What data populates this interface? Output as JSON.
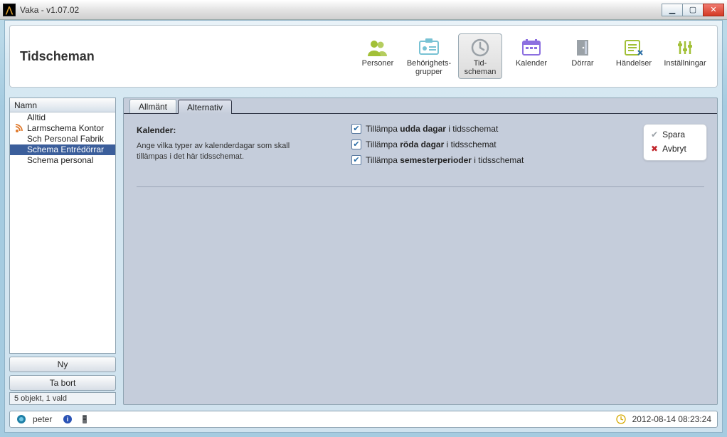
{
  "window": {
    "title": "Vaka - v1.07.02"
  },
  "header": {
    "page_title": "Tidscheman",
    "items": [
      {
        "label": "Personer",
        "icon": "people",
        "color": "#a2c037"
      },
      {
        "label": "Behörighets-\ngrupper",
        "icon": "id-card",
        "color": "#78c2d4"
      },
      {
        "label": "Tid-\nscheman",
        "icon": "clock",
        "color": "#9aa1a7",
        "active": true
      },
      {
        "label": "Kalender",
        "icon": "calendar",
        "color": "#8c6fe0"
      },
      {
        "label": "Dörrar",
        "icon": "door",
        "color": "#9aa1a7"
      },
      {
        "label": "Händelser",
        "icon": "events",
        "color": "#a2c037"
      },
      {
        "label": "Inställningar",
        "icon": "sliders",
        "color": "#a2c037"
      }
    ]
  },
  "sidebar": {
    "header": "Namn",
    "items": [
      {
        "label": "Alltid",
        "icon": ""
      },
      {
        "label": "Larmschema Kontor",
        "icon": "rss"
      },
      {
        "label": "Sch Personal Fabrik",
        "icon": ""
      },
      {
        "label": "Schema Entrédörrar",
        "icon": "",
        "selected": true
      },
      {
        "label": "Schema personal",
        "icon": ""
      }
    ],
    "new_label": "Ny",
    "remove_label": "Ta bort",
    "status": "5 objekt, 1 vald"
  },
  "tabs": {
    "items": [
      {
        "label": "Allmänt"
      },
      {
        "label": "Alternativ",
        "active": true
      }
    ]
  },
  "content": {
    "title": "Kalender:",
    "description": "Ange vilka typer av kalenderdagar som skall tillämpas i det här tidsschemat.",
    "checks": [
      {
        "pre": "Tillämpa ",
        "bold": "udda dagar",
        "post": " i tidsschemat",
        "checked": true
      },
      {
        "pre": "Tillämpa ",
        "bold": "röda dagar",
        "post": " i tidsschemat",
        "checked": true
      },
      {
        "pre": "Tillämpa ",
        "bold": "semesterperioder",
        "post": " i tidsschemat",
        "checked": true
      }
    ],
    "save_label": "Spara",
    "cancel_label": "Avbryt"
  },
  "statusbar": {
    "user": "peter",
    "datetime": "2012-08-14 08:23:24"
  }
}
